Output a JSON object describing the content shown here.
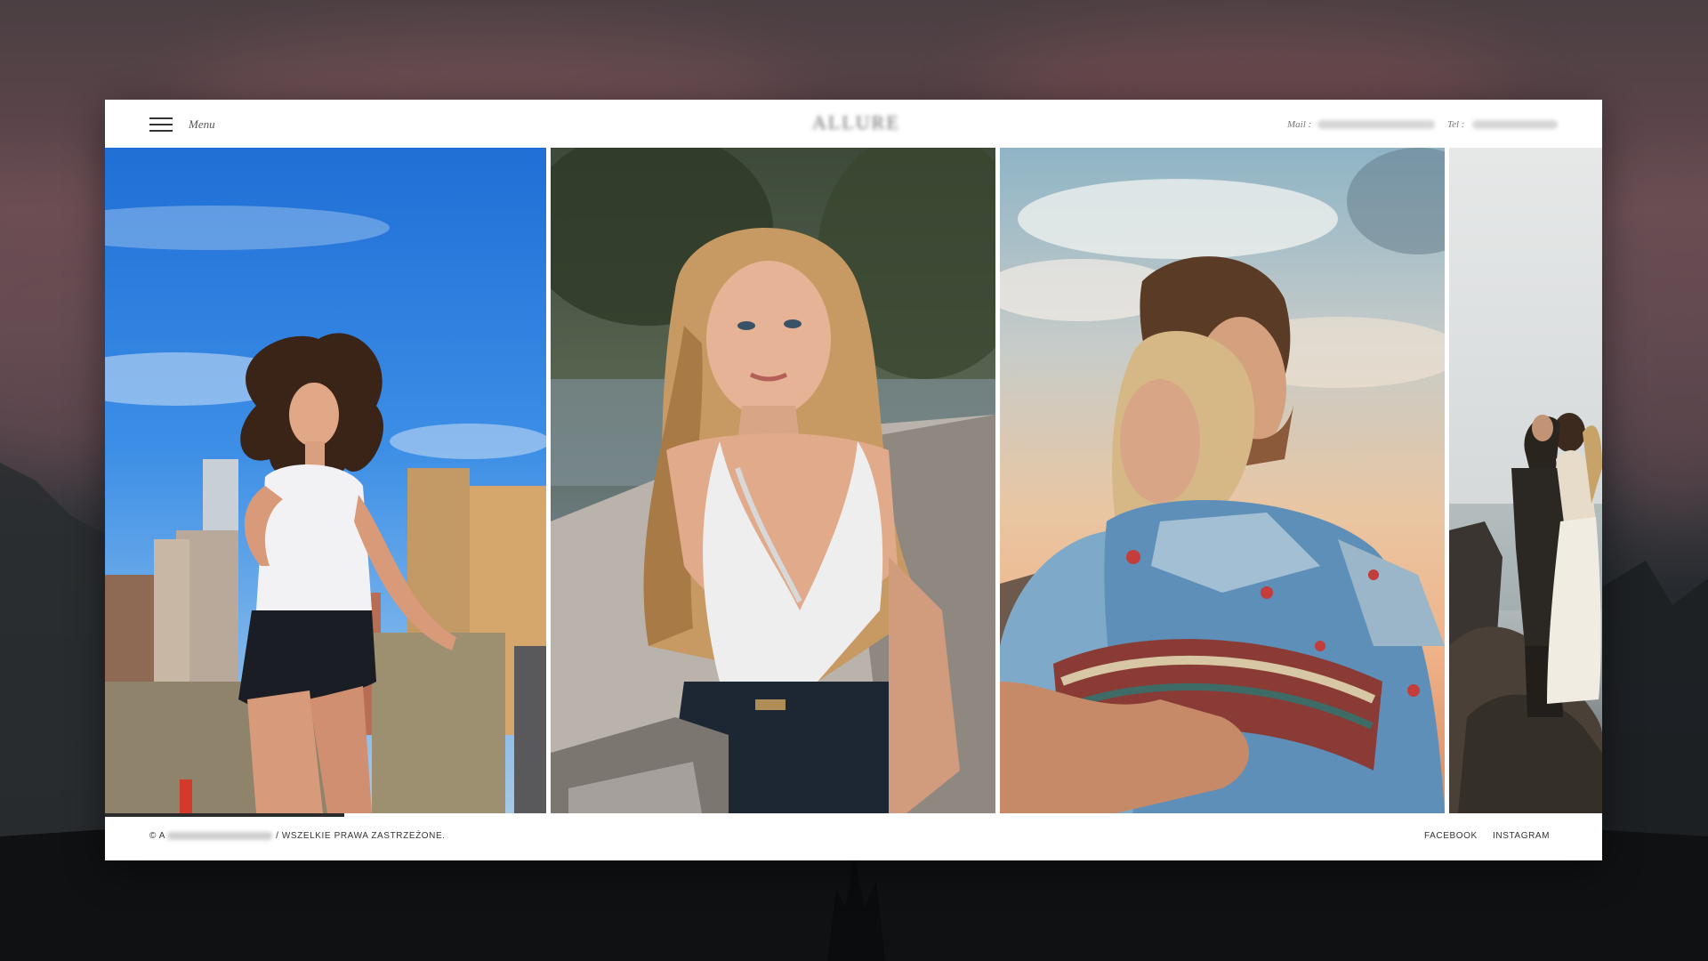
{
  "header": {
    "menu_label": "Menu",
    "brand": "ALLURE",
    "mail_label": "Mail :",
    "tel_label": "Tel :"
  },
  "gallery": {
    "photos": [
      {
        "subject": "woman-flying-hair-city"
      },
      {
        "subject": "blonde-woman-lace-top"
      },
      {
        "subject": "couple-embrace-sunset"
      },
      {
        "subject": "wedding-couple-rocks"
      }
    ],
    "scroll_progress": 0.16
  },
  "footer": {
    "copyright_prefix": "© A",
    "copyright_suffix": "/ WSZELKIE PRAWA ZASTRZEŻONE.",
    "facebook": "FACEBOOK",
    "instagram": "INSTAGRAM"
  },
  "colors": {
    "accent": "#2b2b2b",
    "window_bg": "#ffffff"
  }
}
